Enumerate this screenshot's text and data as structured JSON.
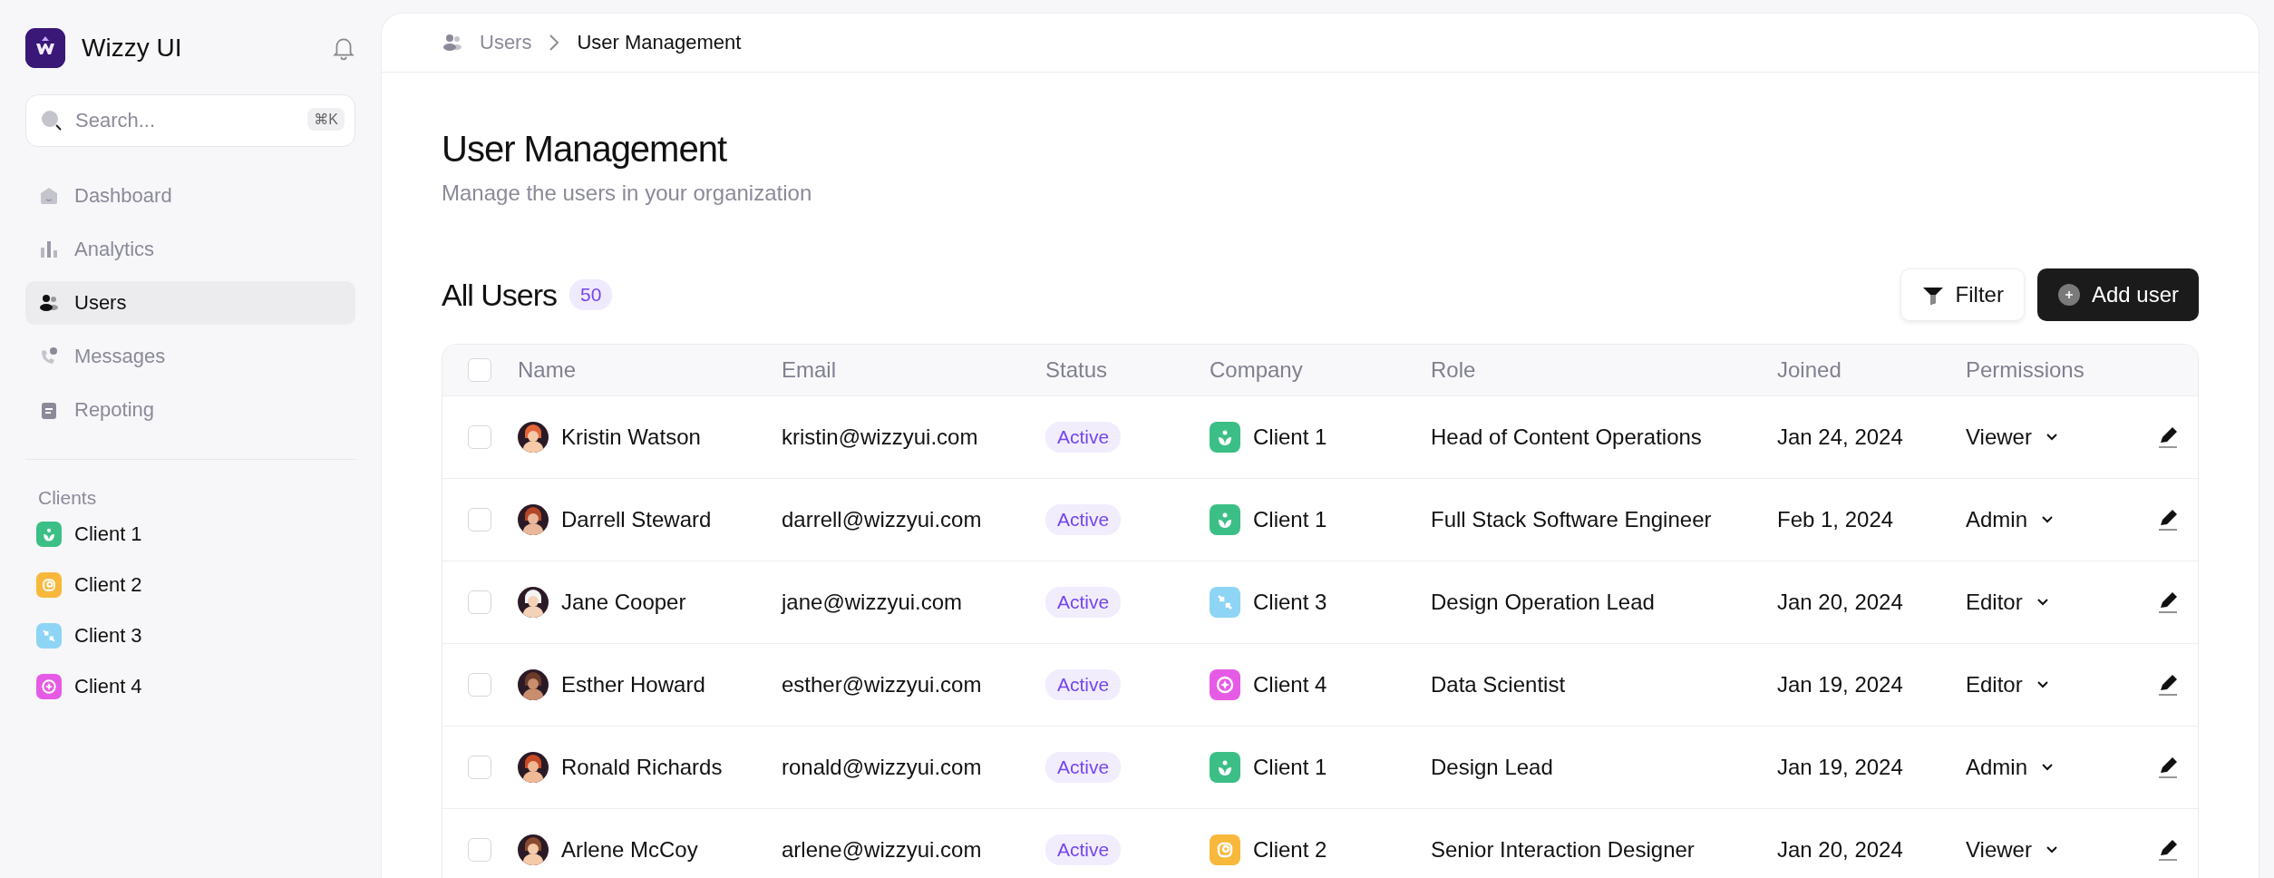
{
  "sidebar": {
    "brand": "Wizzy UI",
    "search": {
      "placeholder": "Search...",
      "shortcut": "⌘K"
    },
    "nav": [
      {
        "label": "Dashboard",
        "selected": false
      },
      {
        "label": "Analytics",
        "selected": false
      },
      {
        "label": "Users",
        "selected": true
      },
      {
        "label": "Messages",
        "selected": false
      },
      {
        "label": "Repoting",
        "selected": false
      }
    ],
    "clients_heading": "Clients",
    "clients": [
      {
        "label": "Client 1",
        "color": "#3cbf86",
        "kind": "leaf"
      },
      {
        "label": "Client 2",
        "color": "#f8b83c",
        "kind": "ring"
      },
      {
        "label": "Client 3",
        "color": "#8ed4f5",
        "kind": "arrows"
      },
      {
        "label": "Client 4",
        "color": "#e65be6",
        "kind": "star"
      }
    ]
  },
  "main": {
    "breadcrumb": [
      "Users",
      "User Management"
    ],
    "title": "User Management",
    "subtitle": "Manage the users in your organization",
    "section_title": "All Users",
    "count": "50",
    "buttons": [
      {
        "label": "Filter",
        "kind": "secondary"
      },
      {
        "label": "Add user",
        "kind": "primary"
      }
    ],
    "table": {
      "select_all_checked": false,
      "columns": [
        "Name",
        "Email",
        "Status",
        "Company",
        "Role",
        "Joined",
        "Permissions"
      ],
      "rows": [
        {
          "checked": false,
          "name": "Kristin Watson",
          "email": "kristin@wizzyui.com",
          "status": "Active",
          "company": {
            "label": "Client 1",
            "color": "#3cbf86",
            "kind": "leaf"
          },
          "role": "Head of Content Operations",
          "joined": "Jan 24, 2024",
          "permission": "Viewer"
        },
        {
          "checked": false,
          "name": "Darrell Steward",
          "email": "darrell@wizzyui.com",
          "status": "Active",
          "company": {
            "label": "Client 1",
            "color": "#3cbf86",
            "kind": "leaf"
          },
          "role": "Full Stack Software Engineer",
          "joined": "Feb 1, 2024",
          "permission": "Admin"
        },
        {
          "checked": false,
          "name": "Jane Cooper",
          "email": "jane@wizzyui.com",
          "status": "Active",
          "company": {
            "label": "Client 3",
            "color": "#8ed4f5",
            "kind": "arrows"
          },
          "role": "Design Operation Lead",
          "joined": "Jan 20, 2024",
          "permission": "Editor"
        },
        {
          "checked": false,
          "name": "Esther Howard",
          "email": "esther@wizzyui.com",
          "status": "Active",
          "company": {
            "label": "Client 4",
            "color": "#e65be6",
            "kind": "star"
          },
          "role": "Data Scientist",
          "joined": "Jan 19, 2024",
          "permission": "Editor"
        },
        {
          "checked": false,
          "name": "Ronald Richards",
          "email": "ronald@wizzyui.com",
          "status": "Active",
          "company": {
            "label": "Client 1",
            "color": "#3cbf86",
            "kind": "leaf"
          },
          "role": "Design Lead",
          "joined": "Jan 19, 2024",
          "permission": "Admin"
        },
        {
          "checked": false,
          "name": "Arlene McCoy",
          "email": "arlene@wizzyui.com",
          "status": "Active",
          "company": {
            "label": "Client 2",
            "color": "#f8b83c",
            "kind": "ring"
          },
          "role": "Senior Interaction Designer",
          "joined": "Jan 20, 2024",
          "permission": "Viewer"
        }
      ]
    }
  }
}
